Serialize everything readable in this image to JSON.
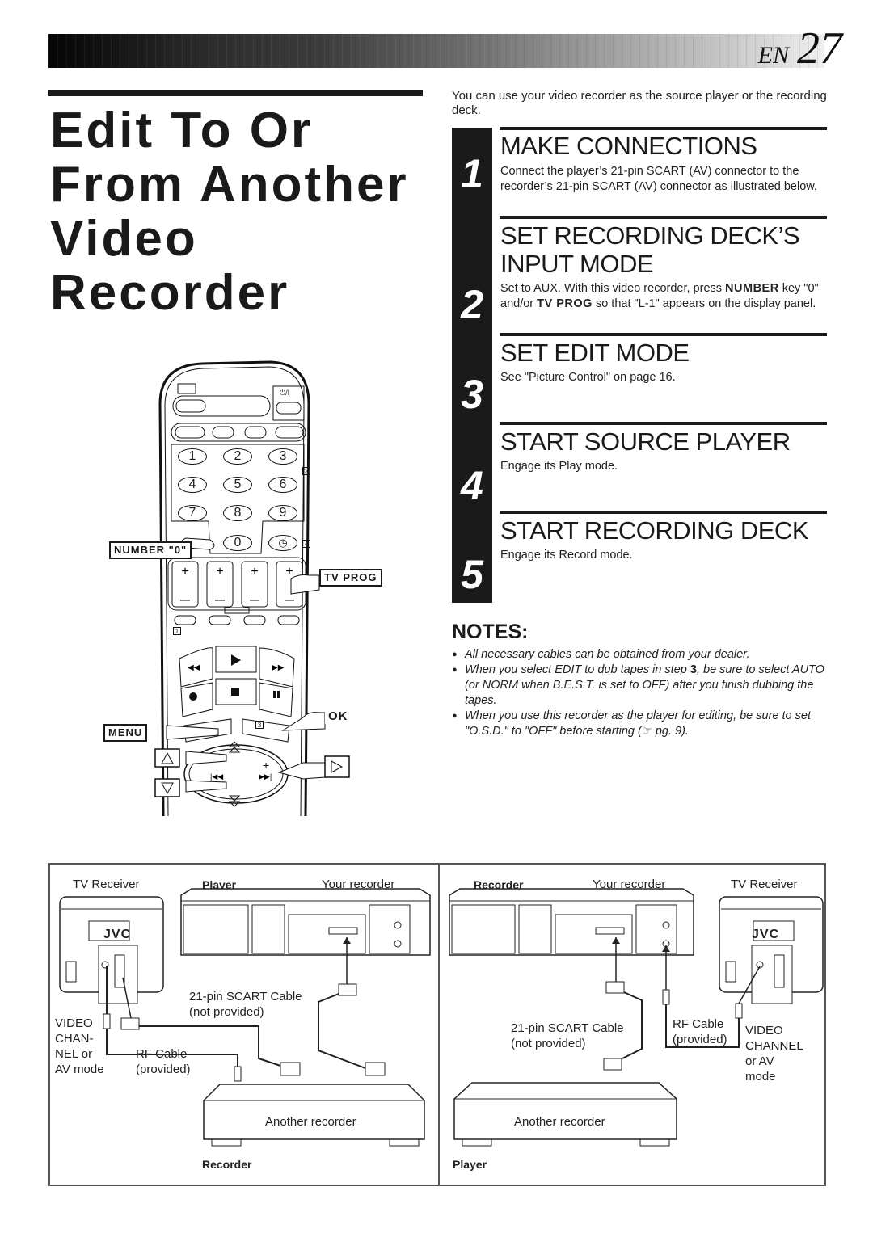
{
  "header": {
    "lang_label": "EN",
    "page_number": "27"
  },
  "title": {
    "lines": [
      "Edit To Or",
      "From Another",
      "Video",
      "Recorder"
    ]
  },
  "intro": "You can use your video recorder as the source player or the recording deck.",
  "steps": [
    {
      "number": "1",
      "heading": "MAKE CONNECTIONS",
      "body": "Connect the player’s 21-pin SCART (AV) connector to the recorder’s 21-pin SCART (AV) connector as illustrated below."
    },
    {
      "number": "2",
      "heading_line1": "SET RECORDING DECK’S",
      "heading_line2": "INPUT MODE",
      "body_pre": "Set to AUX. With this video recorder, press ",
      "body_key1": "NUMBER",
      "body_mid": " key \"0\" and/or ",
      "body_key2": "TV PROG",
      "body_post": " so that \"L-1\" appears on the display panel."
    },
    {
      "number": "3",
      "heading": "SET EDIT MODE",
      "body": "See \"Picture Control\" on page 16."
    },
    {
      "number": "4",
      "heading": "START SOURCE PLAYER",
      "body": "Engage its Play mode."
    },
    {
      "number": "5",
      "heading": "START RECORDING DECK",
      "body": "Engage its Record mode."
    }
  ],
  "notes": {
    "title": "NOTES:",
    "items": [
      {
        "text": "All necessary cables can be obtained from your dealer."
      },
      {
        "pre": "When you select EDIT to dub tapes in step ",
        "bold": "3",
        "post": ", be sure to select AUTO (or NORM when B.E.S.T. is set to OFF) after you finish dubbing the tapes."
      },
      {
        "pre": "When you use this recorder as the player for editing, be sure to set \"O.S.D.\" to  \"OFF\" before starting (",
        "icon": "☞",
        "post": " pg. 9)."
      }
    ]
  },
  "remote": {
    "callouts": {
      "number_zero": "NUMBER \"0\"",
      "tv_prog": "TV PROG",
      "ok": "OK",
      "menu": "MENU"
    },
    "keys": [
      "1",
      "2",
      "3",
      "4",
      "5",
      "6",
      "7",
      "8",
      "9",
      "0"
    ],
    "power_label": "⏻/I",
    "badges": [
      "2",
      "4",
      "1",
      "3"
    ]
  },
  "diagram": {
    "left": {
      "tv_label": "TV Receiver",
      "player_label": "Player",
      "your_recorder_label": "Your recorder",
      "tv_brand": "JVC",
      "scart_cable_line1": "21-pin SCART Cable",
      "scart_cable_line2": "(not provided)",
      "rf_cable_line1": "RF Cable",
      "rf_cable_line2": "(provided)",
      "video_channel_lines": [
        "VIDEO",
        "CHAN-",
        "NEL or",
        "AV mode"
      ],
      "another_recorder": "Another recorder",
      "bottom_role": "Recorder"
    },
    "right": {
      "recorder_label": "Recorder",
      "your_recorder_label": "Your recorder",
      "tv_label": "TV Receiver",
      "tv_brand": "JVC",
      "scart_cable_line1": "21-pin SCART Cable",
      "scart_cable_line2": "(not provided)",
      "rf_cable_line1": "RF Cable",
      "rf_cable_line2": "(provided)",
      "video_channel_lines": [
        "VIDEO",
        "CHANNEL",
        "or AV",
        "mode"
      ],
      "another_recorder": "Another recorder",
      "bottom_role": "Player"
    }
  }
}
